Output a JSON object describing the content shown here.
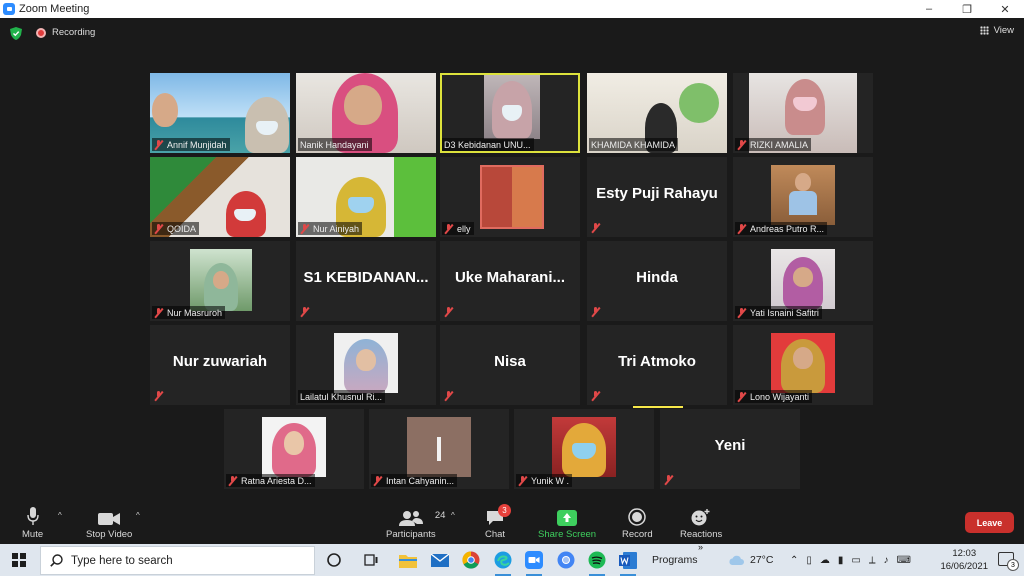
{
  "window": {
    "title": "Zoom Meeting",
    "controls": [
      "–",
      "❐",
      "✕"
    ]
  },
  "topbar": {
    "recording_label": "Recording",
    "view_label": "View"
  },
  "participants": [
    {
      "name": "Annif Munjidah",
      "kind": "video"
    },
    {
      "name": "Nanik Handayani",
      "kind": "video"
    },
    {
      "name": "D3 Kebidanan UNU...",
      "kind": "video",
      "speaking": true
    },
    {
      "name": "KHAMIDA KHAMIDA",
      "kind": "video"
    },
    {
      "name": "RIZKI AMALIA",
      "kind": "video"
    },
    {
      "name": "QOIDA",
      "kind": "video"
    },
    {
      "name": "Nur Ainiyah",
      "kind": "video"
    },
    {
      "name": "elly",
      "kind": "photo"
    },
    {
      "name": "Esty Puji Rahayu",
      "kind": "text"
    },
    {
      "name": "Andreas Putro R...",
      "kind": "photo"
    },
    {
      "name": "Nur Masruroh",
      "kind": "photo"
    },
    {
      "name": "S1  KEBIDANAN...",
      "kind": "text"
    },
    {
      "name": "Uke  Maharani...",
      "kind": "text"
    },
    {
      "name": "Hinda",
      "kind": "text"
    },
    {
      "name": "Yati Isnaini Safitri",
      "kind": "photo"
    },
    {
      "name": "Nur zuwariah",
      "kind": "text"
    },
    {
      "name": "Lailatul Khusnul Ri...",
      "kind": "photo"
    },
    {
      "name": "Nisa",
      "kind": "text"
    },
    {
      "name": "Tri Atmoko",
      "kind": "text"
    },
    {
      "name": "Lono Wijayanti",
      "kind": "photo"
    },
    {
      "name": "Ratna Ariesta D...",
      "kind": "photo"
    },
    {
      "name": "Intan Cahyanin...",
      "kind": "photo"
    },
    {
      "name": "Yunik W .",
      "kind": "photo"
    },
    {
      "name": "Yeni",
      "kind": "text"
    }
  ],
  "toolbar": {
    "mute": "Mute",
    "stop_video": "Stop Video",
    "participants": "Participants",
    "participants_count": "24",
    "chat": "Chat",
    "chat_badge": "3",
    "share_screen": "Share Screen",
    "record": "Record",
    "reactions": "Reactions",
    "leave": "Leave"
  },
  "taskbar": {
    "search_placeholder": "Type here to search",
    "programs": "Programs",
    "weather": "27°C",
    "time": "12:03",
    "date": "16/06/2021",
    "notifications": "3"
  },
  "colors": {
    "speaking_border": "#dde23c",
    "leave": "#c9302c",
    "share": "#3ecf5e",
    "muted": "#e04848"
  }
}
